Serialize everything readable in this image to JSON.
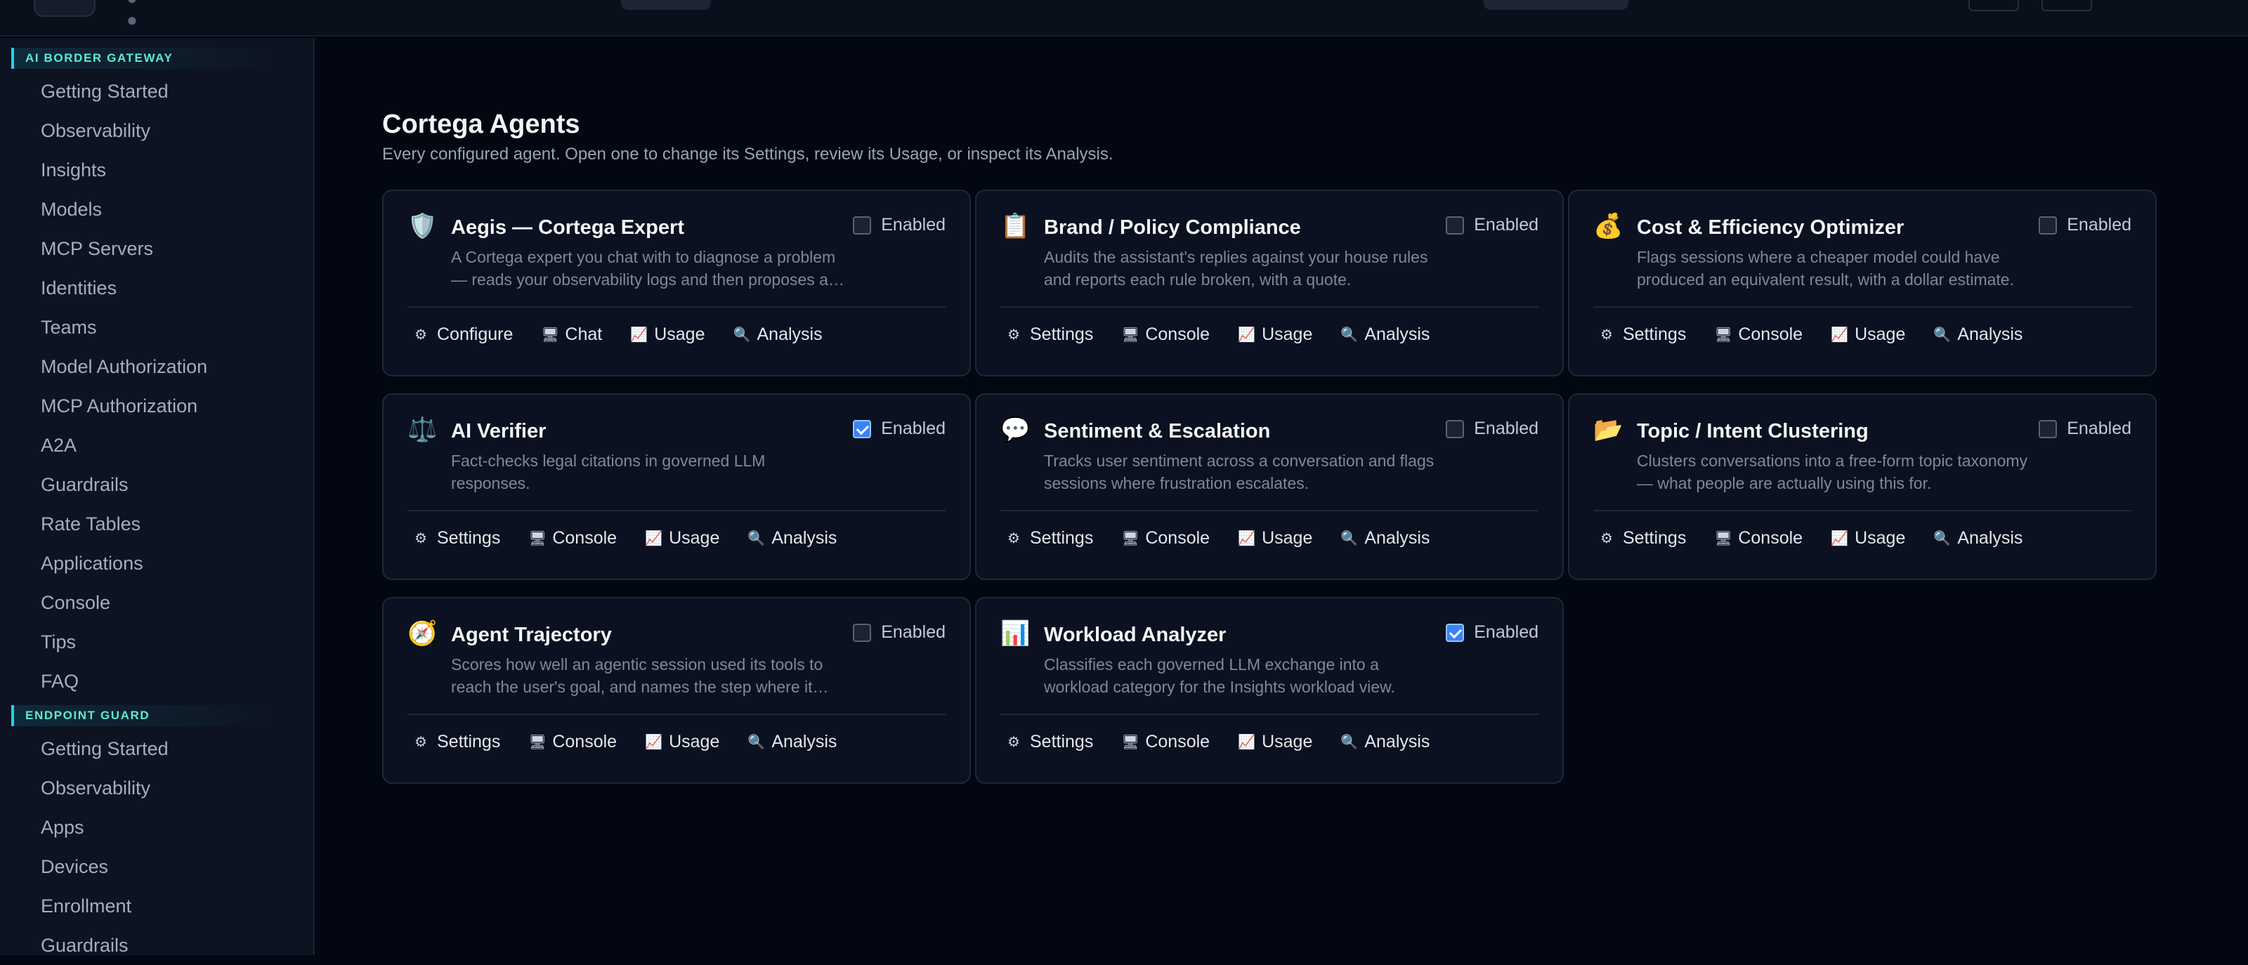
{
  "sidebar": {
    "sections": [
      {
        "header": "AI BORDER GATEWAY",
        "items": [
          "Getting Started",
          "Observability",
          "Insights",
          "Models",
          "MCP Servers",
          "Identities",
          "Teams",
          "Model Authorization",
          "MCP Authorization",
          "A2A",
          "Guardrails",
          "Rate Tables",
          "Applications",
          "Console",
          "Tips",
          "FAQ"
        ]
      },
      {
        "header": "ENDPOINT GUARD",
        "items": [
          "Getting Started",
          "Observability",
          "Apps",
          "Devices",
          "Enrollment",
          "Guardrails"
        ]
      }
    ]
  },
  "page": {
    "title": "Cortega Agents",
    "subtitle": "Every configured agent. Open one to change its Settings, review its Usage, or inspect its Analysis."
  },
  "toggle_label": "Enabled",
  "actions": {
    "settings": "Settings",
    "configure": "Configure",
    "chat": "Chat",
    "console": "Console",
    "usage": "Usage",
    "analysis": "Analysis"
  },
  "icons": {
    "settings": "gear-icon",
    "chat": "monitor-icon",
    "usage": "chart-icon",
    "analysis": "magnifier-icon"
  },
  "agents": [
    {
      "title": "Aegis — Cortega Expert",
      "description": "A Cortega expert you chat with to diagnose a problem — reads your observability logs and then proposes a fix.",
      "icon": "shield-icon",
      "enabled": false,
      "actions": [
        "configure",
        "chat",
        "usage",
        "analysis"
      ]
    },
    {
      "title": "Brand / Policy Compliance",
      "description": "Audits the assistant's replies against your house rules and reports each rule broken, with a quote.",
      "icon": "clipboard-icon",
      "enabled": false,
      "actions": [
        "settings",
        "console",
        "usage",
        "analysis"
      ]
    },
    {
      "title": "Cost & Efficiency Optimizer",
      "description": "Flags sessions where a cheaper model could have produced an equivalent result, with a dollar estimate.",
      "icon": "money-bag-icon",
      "enabled": false,
      "actions": [
        "settings",
        "console",
        "usage",
        "analysis"
      ]
    },
    {
      "title": "AI Verifier",
      "description": "Fact-checks legal citations in governed LLM responses.",
      "icon": "scales-icon",
      "enabled": true,
      "actions": [
        "settings",
        "console",
        "usage",
        "analysis"
      ]
    },
    {
      "title": "Sentiment & Escalation",
      "description": "Tracks user sentiment across a conversation and flags sessions where frustration escalates.",
      "icon": "speech-bubble-icon",
      "enabled": false,
      "actions": [
        "settings",
        "console",
        "usage",
        "analysis"
      ]
    },
    {
      "title": "Topic / Intent Clustering",
      "description": "Clusters conversations into a free-form topic taxonomy — what people are actually using this for.",
      "icon": "folder-icon",
      "enabled": false,
      "actions": [
        "settings",
        "console",
        "usage",
        "analysis"
      ]
    },
    {
      "title": "Agent Trajectory",
      "description": "Scores how well an agentic session used its tools to reach the user's goal, and names the step where it went wrong.",
      "icon": "compass-icon",
      "enabled": false,
      "actions": [
        "settings",
        "console",
        "usage",
        "analysis"
      ]
    },
    {
      "title": "Workload Analyzer",
      "description": "Classifies each governed LLM exchange into a workload category for the Insights workload view.",
      "icon": "bar-chart-icon",
      "enabled": true,
      "actions": [
        "settings",
        "console",
        "usage",
        "analysis"
      ]
    }
  ]
}
